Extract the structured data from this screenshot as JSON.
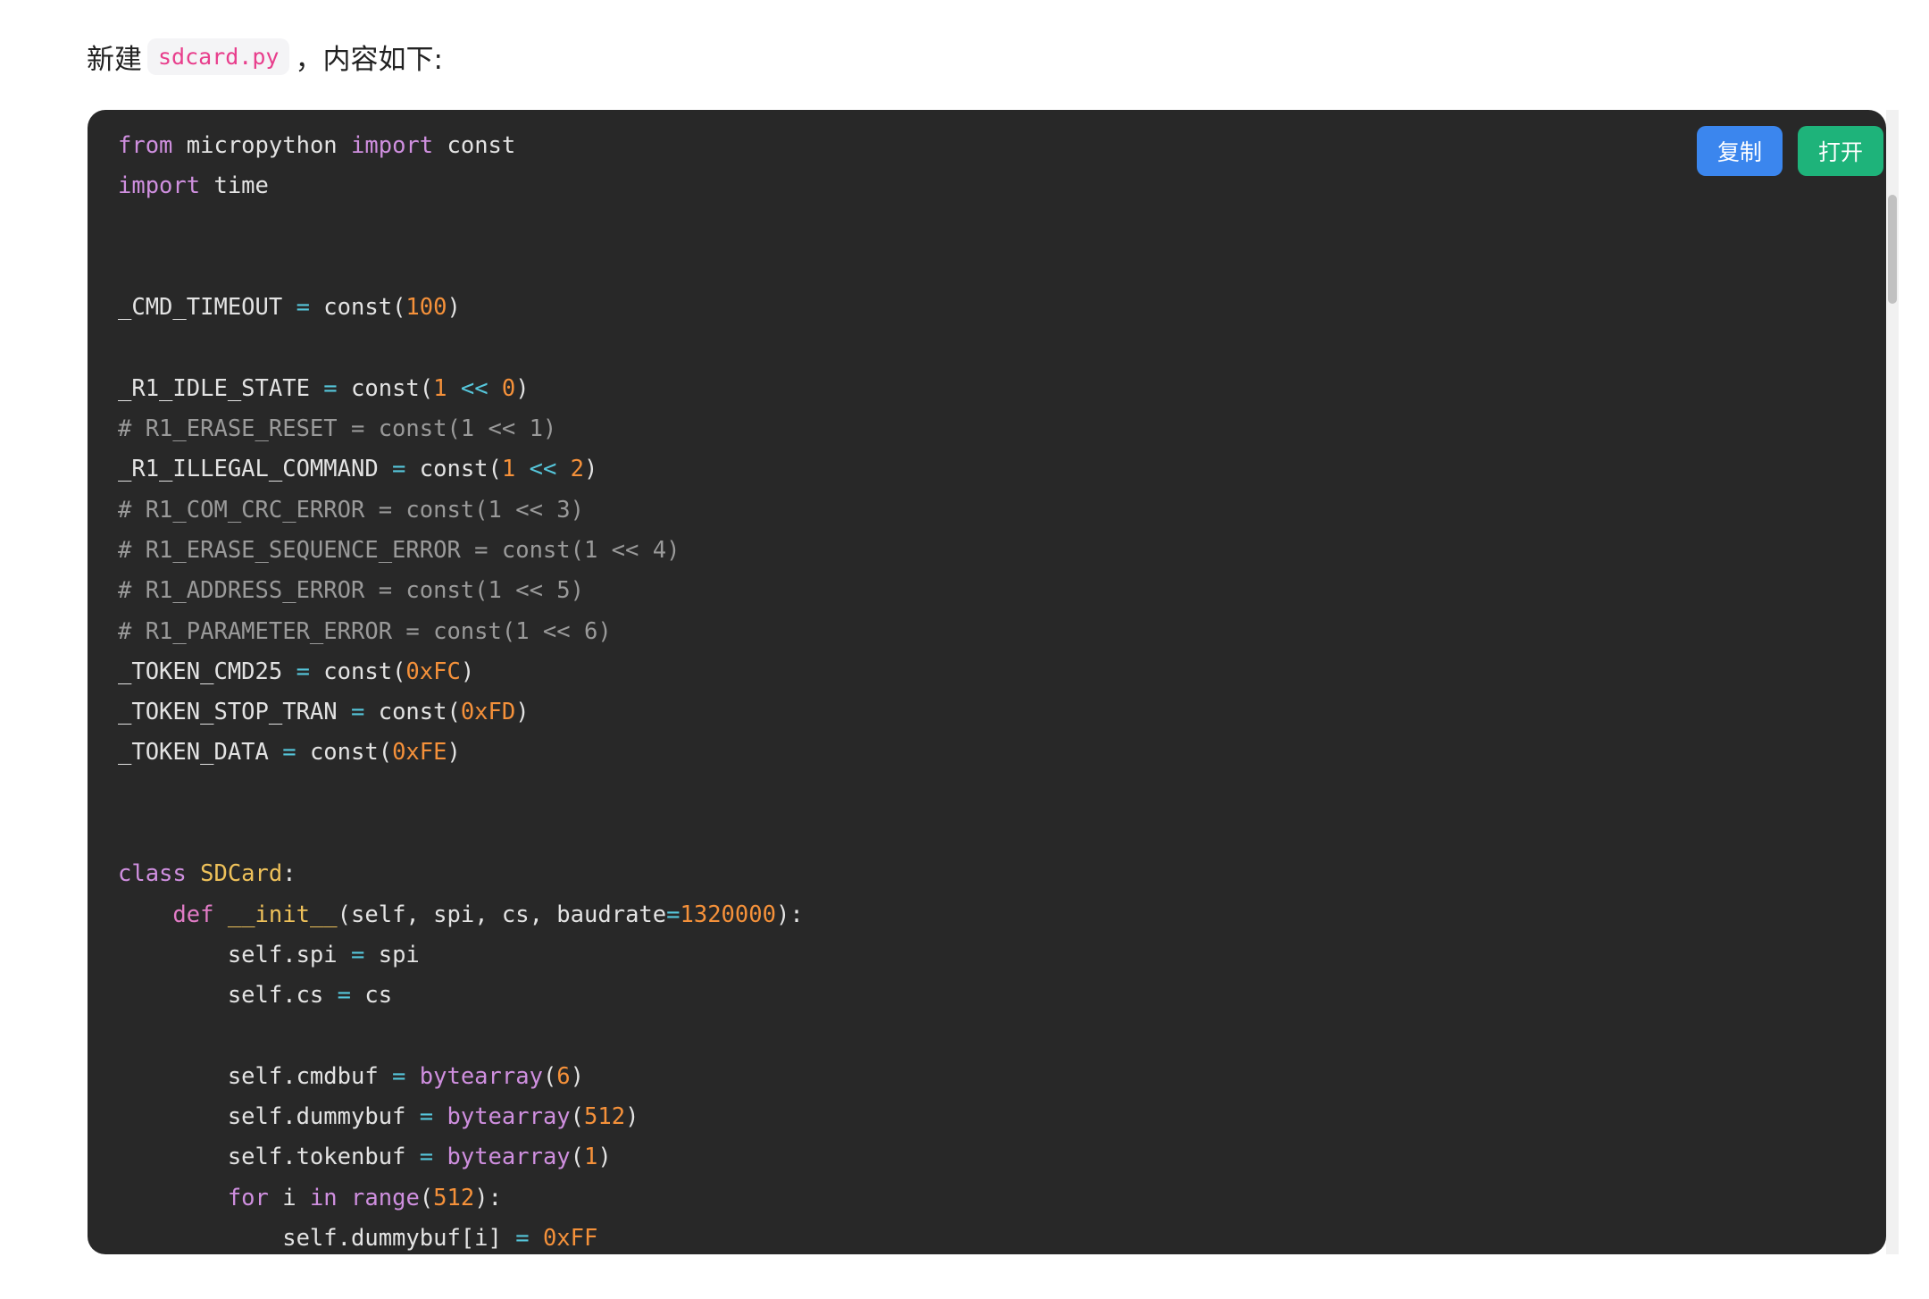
{
  "intro": {
    "prefix": "新建",
    "filename": "sdcard.py",
    "suffix": "，内容如下:"
  },
  "toolbar": {
    "copy_label": "复制",
    "open_label": "打开"
  },
  "colors": {
    "keyword": "#cf8fdf",
    "number": "#f5913a",
    "operator": "#56c7dc",
    "class_name": "#eec15a",
    "comment": "#9a9a9a",
    "text": "#e3e3e3",
    "background": "#282828",
    "copy_button": "#3b86ee",
    "open_button": "#1eb37a"
  },
  "code": {
    "language": "python",
    "lines": [
      [
        {
          "t": "from",
          "k": "keyword"
        },
        {
          "t": " micropython ",
          "k": "plain"
        },
        {
          "t": "import",
          "k": "keyword"
        },
        {
          "t": " const",
          "k": "plain"
        }
      ],
      [
        {
          "t": "import",
          "k": "keyword"
        },
        {
          "t": " time",
          "k": "plain"
        }
      ],
      [],
      [],
      [
        {
          "t": "_CMD_TIMEOUT ",
          "k": "plain"
        },
        {
          "t": "=",
          "k": "op"
        },
        {
          "t": " const(",
          "k": "plain"
        },
        {
          "t": "100",
          "k": "number"
        },
        {
          "t": ")",
          "k": "plain"
        }
      ],
      [],
      [
        {
          "t": "_R1_IDLE_STATE ",
          "k": "plain"
        },
        {
          "t": "=",
          "k": "op"
        },
        {
          "t": " const(",
          "k": "plain"
        },
        {
          "t": "1",
          "k": "number"
        },
        {
          "t": " ",
          "k": "plain"
        },
        {
          "t": "<<",
          "k": "op"
        },
        {
          "t": " ",
          "k": "plain"
        },
        {
          "t": "0",
          "k": "number"
        },
        {
          "t": ")",
          "k": "plain"
        }
      ],
      [
        {
          "t": "# R1_ERASE_RESET = const(1 << 1)",
          "k": "comment"
        }
      ],
      [
        {
          "t": "_R1_ILLEGAL_COMMAND ",
          "k": "plain"
        },
        {
          "t": "=",
          "k": "op"
        },
        {
          "t": " const(",
          "k": "plain"
        },
        {
          "t": "1",
          "k": "number"
        },
        {
          "t": " ",
          "k": "plain"
        },
        {
          "t": "<<",
          "k": "op"
        },
        {
          "t": " ",
          "k": "plain"
        },
        {
          "t": "2",
          "k": "number"
        },
        {
          "t": ")",
          "k": "plain"
        }
      ],
      [
        {
          "t": "# R1_COM_CRC_ERROR = const(1 << 3)",
          "k": "comment"
        }
      ],
      [
        {
          "t": "# R1_ERASE_SEQUENCE_ERROR = const(1 << 4)",
          "k": "comment"
        }
      ],
      [
        {
          "t": "# R1_ADDRESS_ERROR = const(1 << 5)",
          "k": "comment"
        }
      ],
      [
        {
          "t": "# R1_PARAMETER_ERROR = const(1 << 6)",
          "k": "comment"
        }
      ],
      [
        {
          "t": "_TOKEN_CMD25 ",
          "k": "plain"
        },
        {
          "t": "=",
          "k": "op"
        },
        {
          "t": " const(",
          "k": "plain"
        },
        {
          "t": "0xFC",
          "k": "number"
        },
        {
          "t": ")",
          "k": "plain"
        }
      ],
      [
        {
          "t": "_TOKEN_STOP_TRAN ",
          "k": "plain"
        },
        {
          "t": "=",
          "k": "op"
        },
        {
          "t": " const(",
          "k": "plain"
        },
        {
          "t": "0xFD",
          "k": "number"
        },
        {
          "t": ")",
          "k": "plain"
        }
      ],
      [
        {
          "t": "_TOKEN_DATA ",
          "k": "plain"
        },
        {
          "t": "=",
          "k": "op"
        },
        {
          "t": " const(",
          "k": "plain"
        },
        {
          "t": "0xFE",
          "k": "number"
        },
        {
          "t": ")",
          "k": "plain"
        }
      ],
      [],
      [],
      [
        {
          "t": "class",
          "k": "keyword"
        },
        {
          "t": " ",
          "k": "plain"
        },
        {
          "t": "SDCard",
          "k": "class"
        },
        {
          "t": ":",
          "k": "plain"
        }
      ],
      [
        {
          "t": "    ",
          "k": "plain"
        },
        {
          "t": "def",
          "k": "def"
        },
        {
          "t": " ",
          "k": "plain"
        },
        {
          "t": "__init__",
          "k": "fn"
        },
        {
          "t": "(self, spi, cs, baudrate",
          "k": "plain"
        },
        {
          "t": "=",
          "k": "op"
        },
        {
          "t": "1320000",
          "k": "number"
        },
        {
          "t": "):",
          "k": "plain"
        }
      ],
      [
        {
          "t": "        self.spi ",
          "k": "plain"
        },
        {
          "t": "=",
          "k": "op"
        },
        {
          "t": " spi",
          "k": "plain"
        }
      ],
      [
        {
          "t": "        self.cs ",
          "k": "plain"
        },
        {
          "t": "=",
          "k": "op"
        },
        {
          "t": " cs",
          "k": "plain"
        }
      ],
      [],
      [
        {
          "t": "        self.cmdbuf ",
          "k": "plain"
        },
        {
          "t": "=",
          "k": "op"
        },
        {
          "t": " ",
          "k": "plain"
        },
        {
          "t": "bytearray",
          "k": "builtin"
        },
        {
          "t": "(",
          "k": "plain"
        },
        {
          "t": "6",
          "k": "number"
        },
        {
          "t": ")",
          "k": "plain"
        }
      ],
      [
        {
          "t": "        self.dummybuf ",
          "k": "plain"
        },
        {
          "t": "=",
          "k": "op"
        },
        {
          "t": " ",
          "k": "plain"
        },
        {
          "t": "bytearray",
          "k": "builtin"
        },
        {
          "t": "(",
          "k": "plain"
        },
        {
          "t": "512",
          "k": "number"
        },
        {
          "t": ")",
          "k": "plain"
        }
      ],
      [
        {
          "t": "        self.tokenbuf ",
          "k": "plain"
        },
        {
          "t": "=",
          "k": "op"
        },
        {
          "t": " ",
          "k": "plain"
        },
        {
          "t": "bytearray",
          "k": "builtin"
        },
        {
          "t": "(",
          "k": "plain"
        },
        {
          "t": "1",
          "k": "number"
        },
        {
          "t": ")",
          "k": "plain"
        }
      ],
      [
        {
          "t": "        ",
          "k": "plain"
        },
        {
          "t": "for",
          "k": "keyword"
        },
        {
          "t": " i ",
          "k": "plain"
        },
        {
          "t": "in",
          "k": "keyword"
        },
        {
          "t": " ",
          "k": "plain"
        },
        {
          "t": "range",
          "k": "builtin"
        },
        {
          "t": "(",
          "k": "plain"
        },
        {
          "t": "512",
          "k": "number"
        },
        {
          "t": "):",
          "k": "plain"
        }
      ],
      [
        {
          "t": "            self.dummybuf[i] ",
          "k": "plain"
        },
        {
          "t": "=",
          "k": "op"
        },
        {
          "t": " ",
          "k": "plain"
        },
        {
          "t": "0xFF",
          "k": "number"
        }
      ]
    ]
  }
}
